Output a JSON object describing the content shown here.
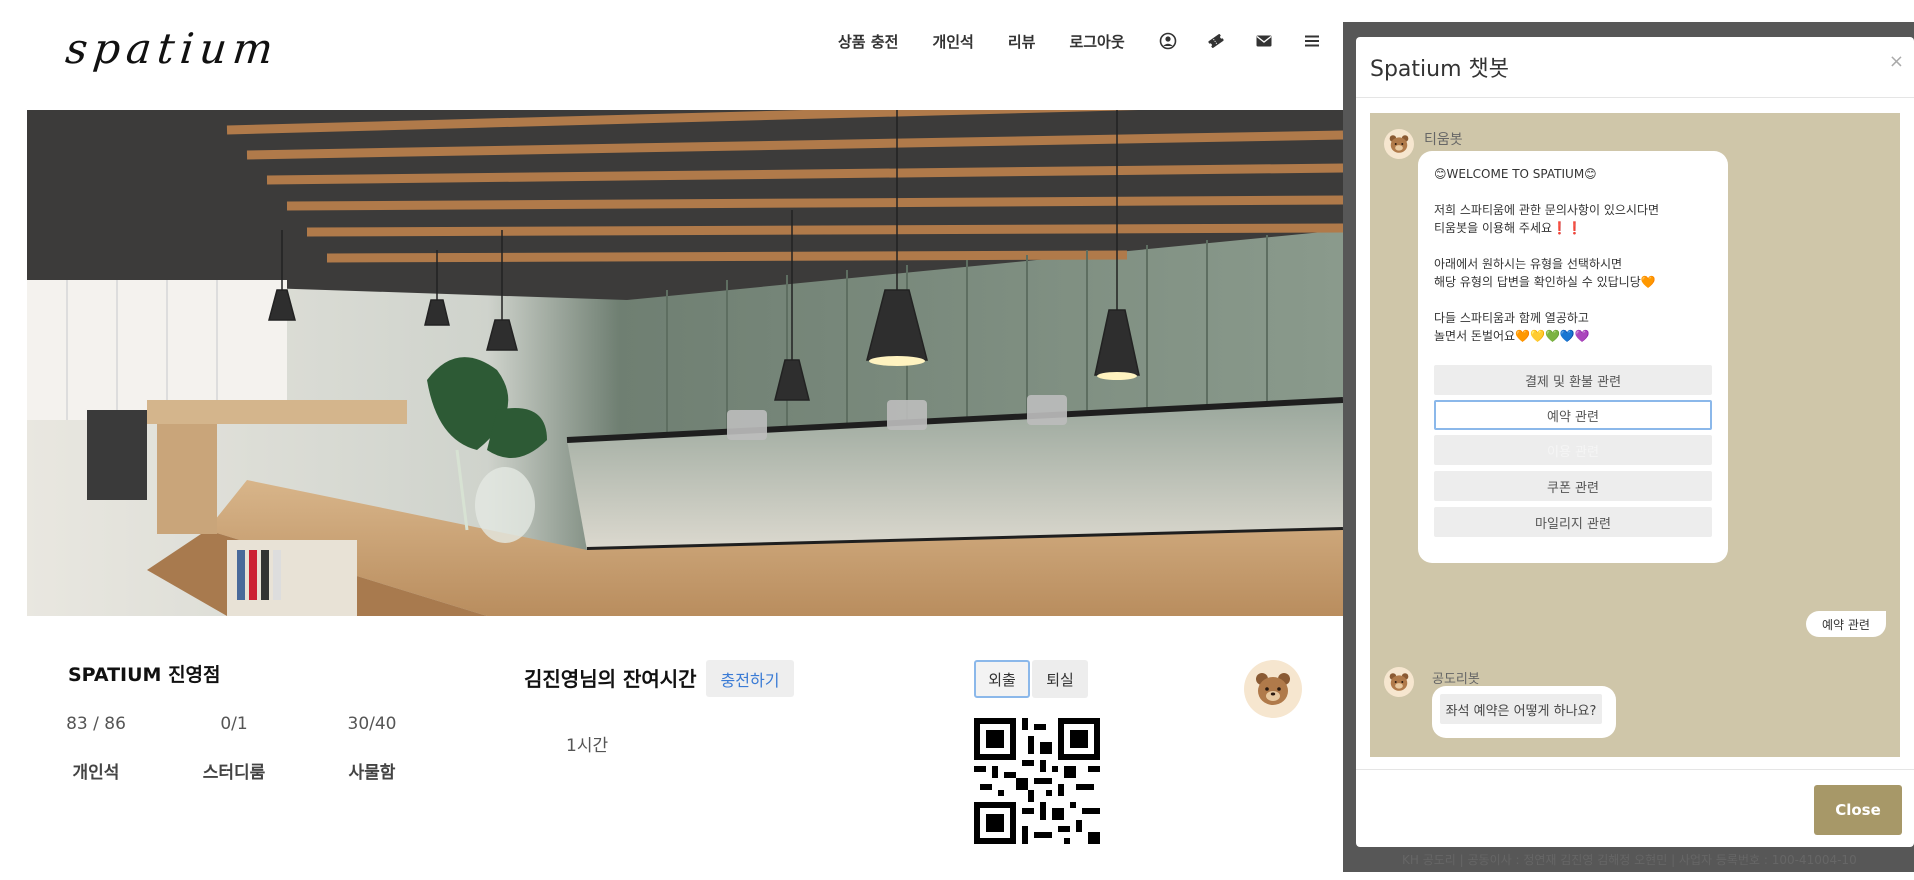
{
  "header": {
    "logo": "spatium",
    "nav": [
      "상품 충전",
      "개인석",
      "리뷰",
      "로그아웃"
    ],
    "icons": [
      "user-circle-icon",
      "ticket-icon",
      "mail-icon",
      "menu-icon"
    ]
  },
  "branch": {
    "title": "SPATIUM 진영점",
    "stats": [
      {
        "value": "83 / 86",
        "label": "개인석"
      },
      {
        "value": "0/1",
        "label": "스터디룸"
      },
      {
        "value": "30/40",
        "label": "사물함"
      }
    ]
  },
  "remain": {
    "title": "김진영님의 잔여시간",
    "charge_label": "충전하기",
    "time": "1시간"
  },
  "actions": {
    "out_label": "외출",
    "leave_label": "퇴실"
  },
  "footer": {
    "text": "KH 공도리 | 공동이사 : 정연재 김진영 김해정 오현민 | 사업자 등록번호 : 100-41004-10"
  },
  "chatbot": {
    "title": "Spatium 챗봇",
    "close_x": "×",
    "close_label": "Close",
    "bot_name_1": "티움봇",
    "welcome": "😊WELCOME TO SPATIUM😊",
    "lines": [
      "저희 스파티움에 관한 문의사항이 있으시다면",
      "티움봇을 이용해 주세요❗❗",
      "아래에서 원하시는 유형을 선택하시면",
      "해당 유형의 답변을 확인하실 수 있답니당🧡",
      "다들 스파티움과 함께 열공하고",
      "놀면서 돈벌어요🧡💛💚💙💜"
    ],
    "choices": [
      "결제 및 환불 관련",
      "예약 관련",
      "이용 관련",
      "쿠폰 관련",
      "마일리지 관련"
    ],
    "user_message": "예약 관련",
    "bot_name_2": "공도리봇",
    "question": "좌석 예약은 어떻게 하나요?"
  },
  "colors": {
    "accent_gold": "#a79868",
    "chat_bg": "#cfc6a9",
    "link_blue": "#3a7bd5",
    "active_border": "#8bb8ea"
  }
}
